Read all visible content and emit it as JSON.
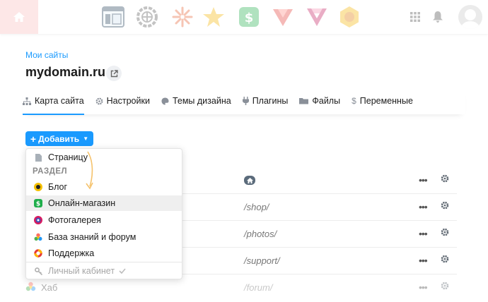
{
  "topbar": {
    "apps": [
      "site-app",
      "installer-app",
      "photos-app",
      "crm-app",
      "shop-app",
      "mailer-app",
      "team-app",
      "hub-app"
    ],
    "icons": [
      "home-icon",
      "grid-icon",
      "bell-icon",
      "avatar"
    ]
  },
  "breadcrumb": "Мои сайты",
  "site": {
    "title": "mydomain.ru"
  },
  "tabs": [
    {
      "label": "Карта сайта",
      "icon": "sitemap-icon",
      "active": true
    },
    {
      "label": "Настройки",
      "icon": "gear-icon",
      "active": false
    },
    {
      "label": "Темы дизайна",
      "icon": "palette-icon",
      "active": false
    },
    {
      "label": "Плагины",
      "icon": "plug-icon",
      "active": false
    },
    {
      "label": "Файлы",
      "icon": "folder-icon",
      "active": false
    },
    {
      "label": "Переменные",
      "icon": "dollar-icon",
      "active": false
    }
  ],
  "add_button": {
    "plus": "+",
    "label": "Добавить"
  },
  "dropdown": {
    "page_label": "Страницу",
    "section_label": "РАЗДЕЛ",
    "items": [
      {
        "label": "Блог",
        "icon": "blog-icon"
      },
      {
        "label": "Онлайн-магазин",
        "icon": "shop-icon"
      },
      {
        "label": "Фотогалерея",
        "icon": "photos-icon"
      },
      {
        "label": "База знаний и форум",
        "icon": "hub-icon"
      },
      {
        "label": "Поддержка",
        "icon": "helpdesk-icon"
      }
    ],
    "footer_label": "Личный кабинет"
  },
  "rows": [
    {
      "url": ""
    },
    {
      "url": "/shop/"
    },
    {
      "url": "/photos/"
    },
    {
      "url": "/support/"
    },
    {
      "name": "Хаб",
      "url": "/forum/"
    }
  ],
  "colors": {
    "accent": "#1a9afe",
    "highlight": "#efefef"
  }
}
